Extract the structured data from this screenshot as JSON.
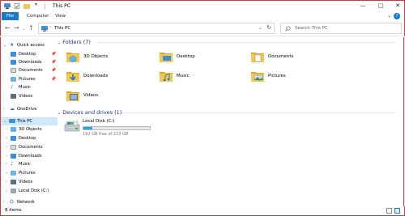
{
  "window": {
    "title": "This PC",
    "controls": [
      "—",
      "□",
      "✕"
    ]
  },
  "ribbon": {
    "tabs": [
      "File",
      "Computer",
      "View"
    ],
    "help": "?",
    "expand": "⌄"
  },
  "address": {
    "path": "This PC",
    "search_placeholder": "Search This PC"
  },
  "nav": {
    "quick_access": "Quick access",
    "quick_items": [
      "Desktop",
      "Downloads",
      "Documents",
      "Pictures",
      "Music",
      "Videos"
    ],
    "onedrive": "OneDrive",
    "this_pc": "This PC",
    "pc_items": [
      "3D Objects",
      "Desktop",
      "Documents",
      "Downloads",
      "Music",
      "Pictures",
      "Videos",
      "Local Disk (C:)"
    ],
    "network": "Network"
  },
  "content": {
    "folders_header": "Folders (7)",
    "folders": [
      "3D Objects",
      "Desktop",
      "Documents",
      "Downloads",
      "Music",
      "Pictures",
      "Videos"
    ],
    "drives_header": "Devices and drives (1)",
    "drive": {
      "label": "Local Disk (C:)",
      "free_text": "192 GB free of 223 GB",
      "used_fraction": 0.14
    }
  },
  "status": {
    "items": "8 items"
  },
  "colors": {
    "accent": "#1979ca",
    "folder": "#f4c64f",
    "folder_dark": "#e5a823",
    "selection": "#cce8ff",
    "header_text": "#1e3287",
    "window_border": "#dd3333"
  }
}
